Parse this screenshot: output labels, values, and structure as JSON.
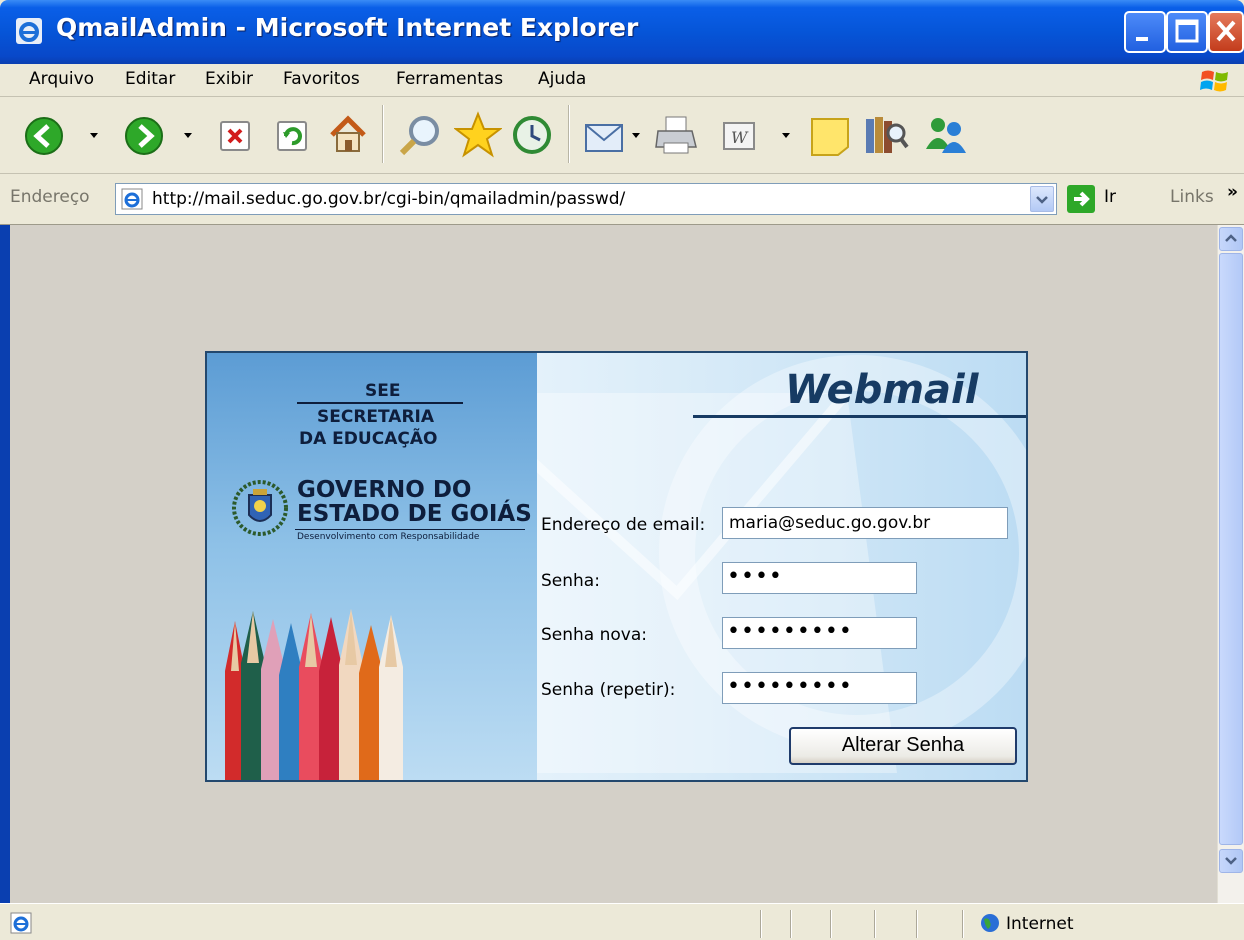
{
  "window": {
    "title": "QmailAdmin - Microsoft Internet Explorer"
  },
  "menu": {
    "items": [
      "Arquivo",
      "Editar",
      "Exibir",
      "Favoritos",
      "Ferramentas",
      "Ajuda"
    ]
  },
  "toolbar": {
    "icons": [
      "back-icon",
      "forward-icon",
      "stop-icon",
      "refresh-icon",
      "home-icon",
      "search-icon",
      "favorites-icon",
      "history-icon",
      "mail-icon",
      "print-icon",
      "word-edit-icon",
      "discuss-icon",
      "research-icon",
      "messenger-icon"
    ]
  },
  "address": {
    "label": "Endereço",
    "url": "http://mail.seduc.go.gov.br/cgi-bin/qmailadmin/passwd/",
    "go_label": "Ir",
    "links_label": "Links",
    "chevron": "»"
  },
  "page": {
    "see": "SEE",
    "secretaria_line1": "SECRETARIA",
    "secretaria_line2": "DA EDUCAÇÃO",
    "governo_line1": "GOVERNO DO",
    "governo_line2": "ESTADO DE GOIÁS",
    "slogan": "Desenvolvimento com Responsabilidade",
    "webmail_title": "Webmail",
    "form": {
      "email_label": "Endereço de email:",
      "email_value": "maria@seduc.go.gov.br",
      "senha_label": "Senha:",
      "senha_value": "••••",
      "senha_nova_label": "Senha nova:",
      "senha_nova_value": "•••••••••",
      "senha_repetir_label": "Senha (repetir):",
      "senha_repetir_value": "•••••••••",
      "submit_label": "Alterar Senha"
    }
  },
  "status": {
    "zone": "Internet"
  },
  "colors": {
    "titlebar": "#0655d8",
    "content_bg": "#d4d0c8",
    "panel_border": "#23486e",
    "webmail_text": "#173b63"
  }
}
